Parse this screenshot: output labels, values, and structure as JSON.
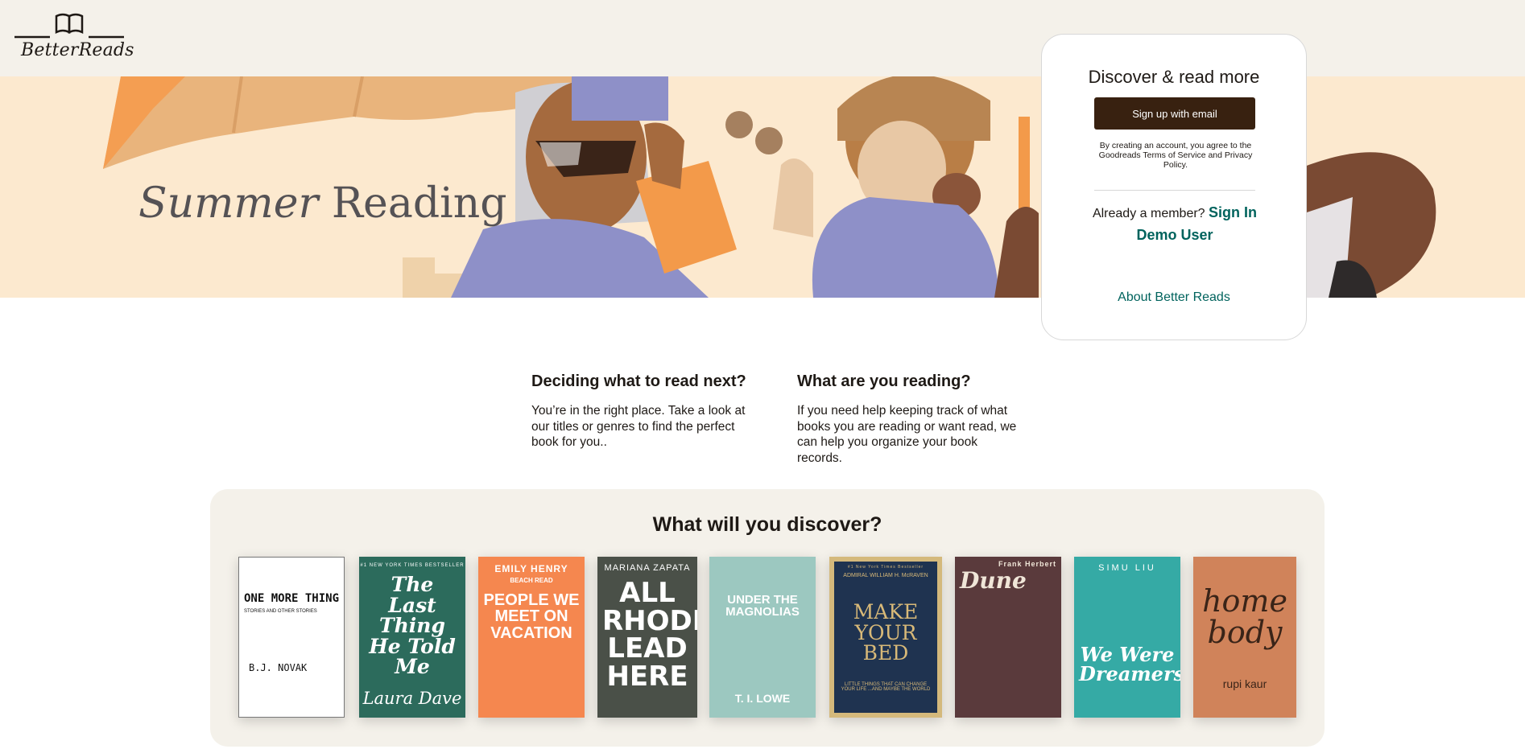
{
  "header": {
    "logo_text": "BetterReads"
  },
  "hero": {
    "title_italic": "Summer",
    "title_rest": "Reading"
  },
  "signup_card": {
    "title": "Discover & read more",
    "signup_button": "Sign up with email",
    "terms": "By creating an account, you agree to the Goodreads Terms of Service and Privacy Policy.",
    "already_member": "Already a member?",
    "sign_in": "Sign In",
    "demo_user": "Demo User",
    "about": "About Better Reads"
  },
  "info": {
    "left": {
      "heading": "Deciding what to read next?",
      "body": "You’re in the right place. Take a look at our titles or genres to find the perfect book for you.."
    },
    "right": {
      "heading": "What are you reading?",
      "body": "If you need help keeping track of what books you are reading or want read, we can help you organize your book records."
    }
  },
  "discover": {
    "heading": "What will you discover?",
    "books": [
      {
        "top": "",
        "title": "ONE MORE THING",
        "subtitle": "STORIES AND OTHER STORIES",
        "author": "B.J. NOVAK",
        "bg": "#ffffff",
        "fg": "#111111"
      },
      {
        "top": "#1 NEW YORK TIMES BESTSELLER",
        "title": "The Last Thing He Told Me",
        "subtitle": "",
        "author": "Laura Dave",
        "bg": "#2c6b5c",
        "fg": "#ffffff"
      },
      {
        "top": "EMILY HENRY",
        "title": "PEOPLE WE MEET ON VACATION",
        "subtitle": "BEACH READ",
        "author": "",
        "bg": "#f5874f",
        "fg": "#ffffff"
      },
      {
        "top": "MARIANA ZAPATA",
        "title": "ALL RHODES LEAD HERE",
        "subtitle": "",
        "author": "",
        "bg": "#4a5048",
        "fg": "#ffffff"
      },
      {
        "top": "",
        "title": "UNDER THE MAGNOLIAS",
        "subtitle": "",
        "author": "T. I. LOWE",
        "bg": "#9cc8c0",
        "fg": "#ffffff"
      },
      {
        "top": "#1 New York Times Bestseller",
        "title": "MAKE YOUR BED",
        "subtitle": "ADMIRAL WILLIAM H. McRAVEN",
        "author": "LITTLE THINGS THAT CAN CHANGE YOUR LIFE ...AND MAYBE THE WORLD",
        "bg": "#1f3350",
        "fg": "#d8b978"
      },
      {
        "top": "Frank Herbert",
        "title": "Dune",
        "subtitle": "",
        "author": "",
        "bg": "#5a3a3c",
        "fg": "#f0e6d8"
      },
      {
        "top": "SIMU LIU",
        "title": "We Were Dreamers",
        "subtitle": "",
        "author": "",
        "bg": "#35aaa5",
        "fg": "#ffffff"
      },
      {
        "top": "",
        "title": "home body",
        "subtitle": "",
        "author": "rupi kaur",
        "bg": "#d0835a",
        "fg": "#3a2418"
      }
    ]
  },
  "colors": {
    "header_bg": "#f4f1ea",
    "hero_bg": "#fce9cf",
    "button_bg": "#382110",
    "link": "#00635d",
    "panel_bg": "#f4f1ea"
  }
}
